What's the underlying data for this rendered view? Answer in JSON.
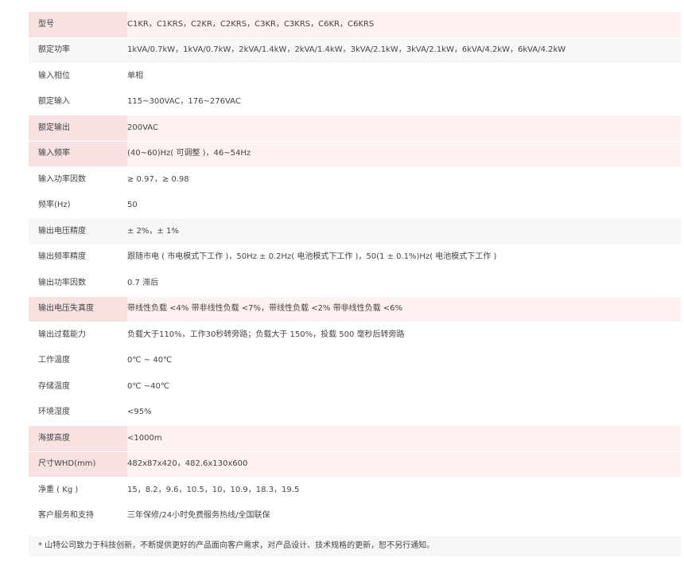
{
  "rows": [
    {
      "label": "型号",
      "value": "C1KR，C1KRS，C2KR，C2KRS，C3KR，C3KRS，C6KR，C6KRS"
    },
    {
      "label": "额定功率",
      "value": "1kVA/0.7kW，1kVA/0.7kW，2kVA/1.4kW，2kVA/1.4kW，3kVA/2.1kW，3kVA/2.1kW，6kVA/4.2kW，6kVA/4.2kW"
    },
    {
      "label": "输入相位",
      "value": "单相"
    },
    {
      "label": "额定输入",
      "value": "115~300VAC，176~276VAC"
    },
    {
      "label": "额定输出",
      "value": "200VAC"
    },
    {
      "label": "输入频率",
      "value": "(40~60)Hz( 可调整 )，46~54Hz"
    },
    {
      "label": "输入功率因数",
      "value": "≥ 0.97，≥ 0.98"
    },
    {
      "label": "频率(Hz)",
      "value": "50"
    },
    {
      "label": "输出电压精度",
      "value": "± 2%，± 1%"
    },
    {
      "label": "输出频率精度",
      "value": "跟随市电 ( 市电模式下工作 )，50Hz ± 0.2Hz( 电池模式下工作 )，50(1 ± 0.1%)Hz( 电池模式下工作 )"
    },
    {
      "label": "输出功率因数",
      "value": "0.7 滞后"
    },
    {
      "label": "输出电压失真度",
      "value": "带线性负载 <4% 带非线性负载 <7%，带线性负载 <2% 带非线性负载 <6%"
    },
    {
      "label": "输出过载能力",
      "value": "负载大于110%，工作30秒转旁路；负载大于 150%，投载 500 毫秒后转旁路"
    },
    {
      "label": "工作温度",
      "value": "0℃ ~ 40℃"
    },
    {
      "label": "存储温度",
      "value": "0℃ ~40℃"
    },
    {
      "label": "环境湿度",
      "value": "<95%"
    },
    {
      "label": "海拔高度",
      "value": "<1000m"
    },
    {
      "label": "尺寸WHD(mm)",
      "value": "482x87x420，482.6x130x600"
    },
    {
      "label": "净重 ( Kg )",
      "value": "15，8.2，9.6，10.5，10，10.9，18.3，19.5"
    },
    {
      "label": "客户服务和支持",
      "value": "三年保修/24小时免费服务热线/全国联保"
    }
  ],
  "footnote": "* 山特公司致力于科技创新，不断提供更好的产品面向客户需求，对产品设计、技术规格的更新，恕不另行通知。",
  "colors": {
    "row_pink": "#fdf1f1",
    "label_pink": "#f7e1e1",
    "row_gray": "#f7f7f7",
    "row_white": "#ffffff"
  }
}
